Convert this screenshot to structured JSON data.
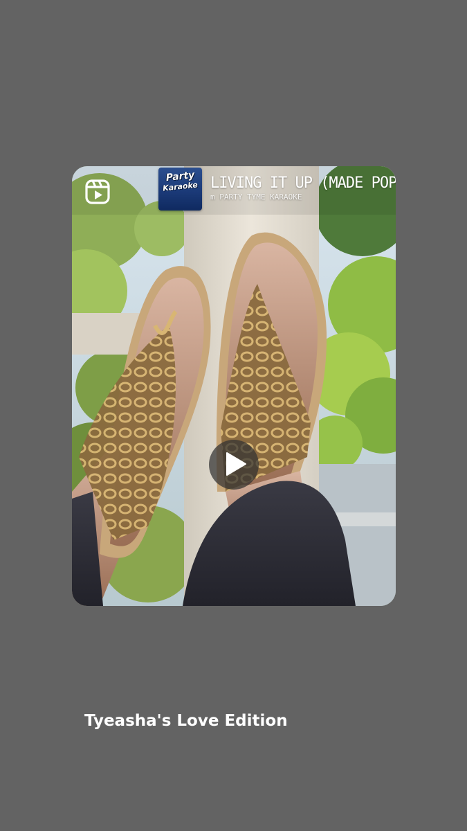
{
  "post": {
    "type_icon": "reels-icon",
    "caption": "Tyeasha's Love Edition"
  },
  "audio": {
    "song_title": "LIVING IT UP (MADE POPUL",
    "artist": "m PARTY TYME KARAOKE",
    "album_art_line1": "Party",
    "album_art_line2": "Karaoke",
    "album_art_line3": "Tyme"
  },
  "player": {
    "play_icon": "play-icon"
  },
  "colors": {
    "background": "#636363",
    "caption_text": "#ffffff",
    "play_button_bg": "#323232"
  }
}
